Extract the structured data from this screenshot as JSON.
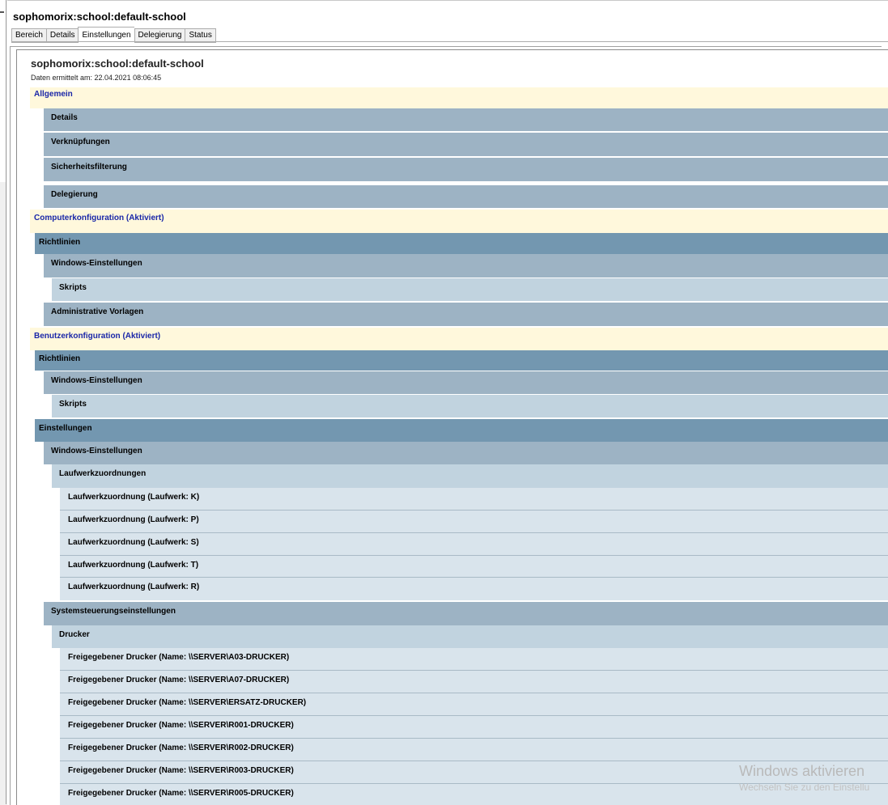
{
  "window": {
    "title": "sophomorix:school:default-school"
  },
  "tabs": [
    {
      "label": "Bereich",
      "active": false
    },
    {
      "label": "Details",
      "active": false
    },
    {
      "label": "Einstellungen",
      "active": true
    },
    {
      "label": "Delegierung",
      "active": false
    },
    {
      "label": "Status",
      "active": false
    }
  ],
  "report": {
    "title": "sophomorix:school:default-school",
    "date": "Daten ermittelt am: 22.04.2021 08:06:45",
    "rows": [
      "Allgemein",
      "Details",
      "Verknüpfungen",
      "Sicherheitsfilterung",
      "Delegierung",
      "Computerkonfiguration (Aktiviert)",
      "Richtlinien",
      "Windows-Einstellungen",
      "Skripts",
      "Administrative Vorlagen",
      "Benutzerkonfiguration (Aktiviert)",
      "Richtlinien",
      "Windows-Einstellungen",
      "Skripts",
      "Einstellungen",
      "Windows-Einstellungen",
      "Laufwerkzuordnungen",
      "Laufwerkzuordnung (Laufwerk: K)",
      "Laufwerkzuordnung (Laufwerk: P)",
      "Laufwerkzuordnung (Laufwerk: S)",
      "Laufwerkzuordnung (Laufwerk: T)",
      "Laufwerkzuordnung (Laufwerk: R)",
      "Systemsteuerungseinstellungen",
      "Drucker",
      "Freigegebener Drucker (Name: \\\\SERVER\\A03-DRUCKER)",
      "Freigegebener Drucker (Name: \\\\SERVER\\A07-DRUCKER)",
      "Freigegebener Drucker (Name: \\\\SERVER\\ERSATZ-DRUCKER)",
      "Freigegebener Drucker (Name: \\\\SERVER\\R001-DRUCKER)",
      "Freigegebener Drucker (Name: \\\\SERVER\\R002-DRUCKER)",
      "Freigegebener Drucker (Name: \\\\SERVER\\R003-DRUCKER)",
      "Freigegebener Drucker (Name: \\\\SERVER\\R005-DRUCKER)"
    ]
  },
  "watermark": {
    "line1": "Windows aktivieren",
    "line2": "Wechseln Sie zu den Einstellu"
  }
}
